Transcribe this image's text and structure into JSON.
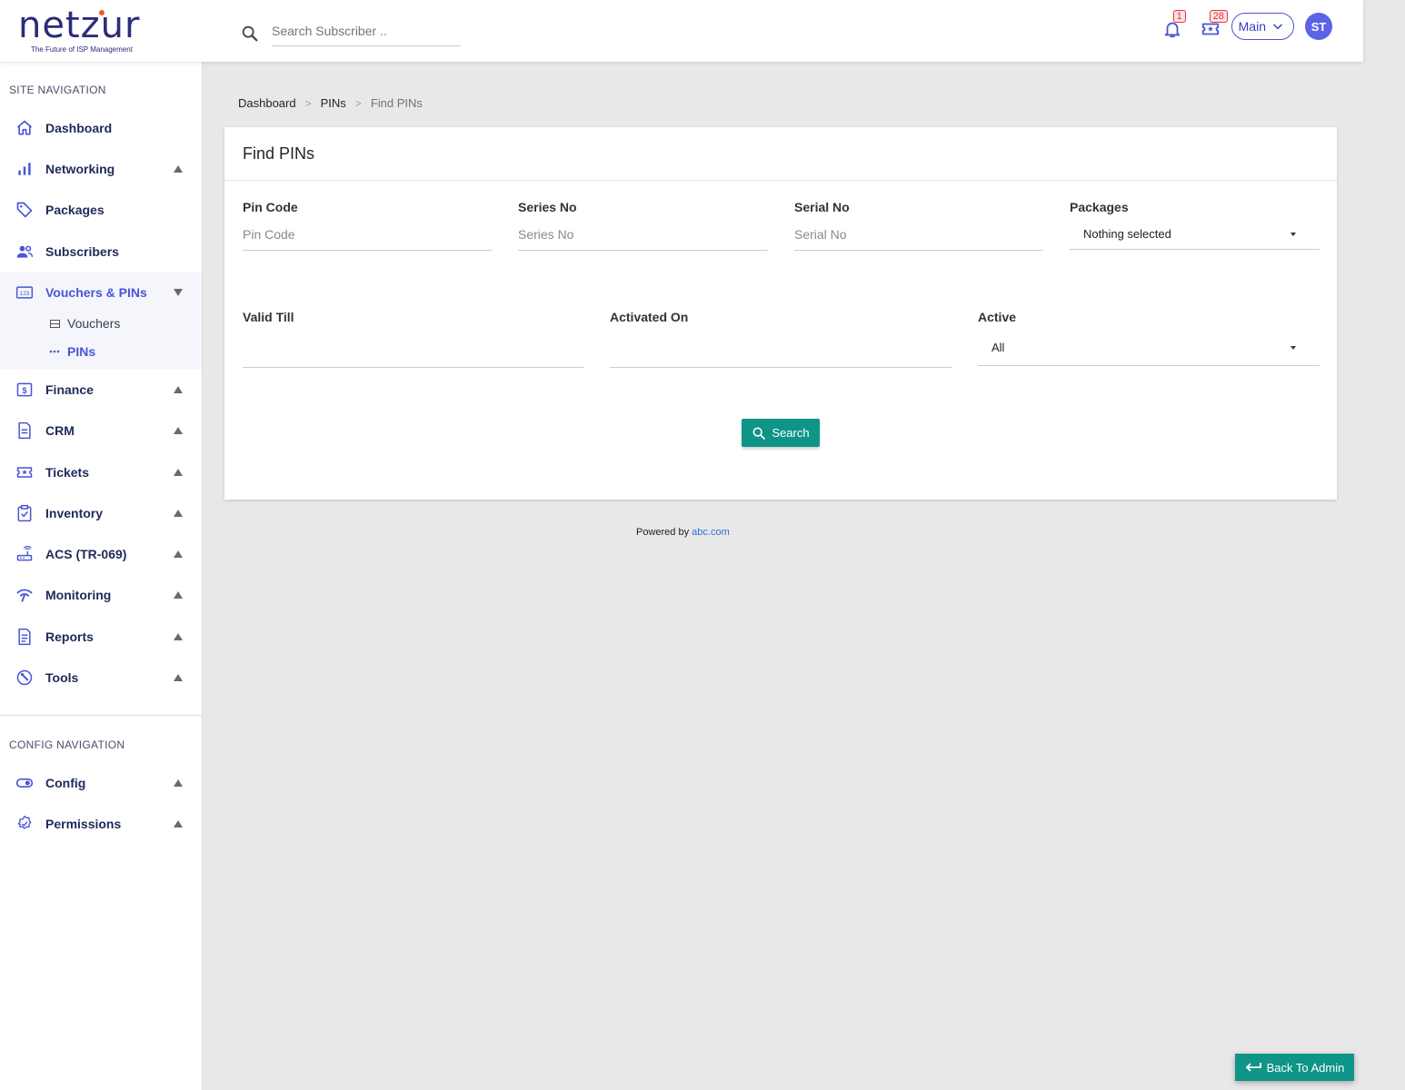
{
  "brand": {
    "name": "netzur",
    "tagline": "The Future of ISP Management"
  },
  "header": {
    "search_placeholder": "Search Subscriber ..",
    "notifications_count": "1",
    "tickets_count": "28",
    "context_select": "Main",
    "avatar_initials": "ST"
  },
  "sidebar": {
    "site_heading": "SITE NAVIGATION",
    "config_heading": "CONFIG NAVIGATION",
    "items": [
      {
        "label": "Dashboard",
        "icon": "home-icon"
      },
      {
        "label": "Networking",
        "icon": "bar-chart-icon"
      },
      {
        "label": "Packages",
        "icon": "tag-icon"
      },
      {
        "label": "Subscribers",
        "icon": "users-icon"
      },
      {
        "label": "Vouchers & PINs",
        "icon": "numbers-icon"
      },
      {
        "label": "Finance",
        "icon": "dollar-icon"
      },
      {
        "label": "CRM",
        "icon": "document-icon"
      },
      {
        "label": "Tickets",
        "icon": "ticket-icon"
      },
      {
        "label": "Inventory",
        "icon": "clipboard-check-icon"
      },
      {
        "label": "ACS (TR-069)",
        "icon": "router-icon"
      },
      {
        "label": "Monitoring",
        "icon": "signal-icon"
      },
      {
        "label": "Reports",
        "icon": "report-icon"
      },
      {
        "label": "Tools",
        "icon": "wrench-icon"
      }
    ],
    "sub_items": [
      {
        "label": "Vouchers",
        "icon": "list-icon"
      },
      {
        "label": "PINs",
        "icon": "dots-icon"
      }
    ],
    "config_items": [
      {
        "label": "Config",
        "icon": "toggle-icon"
      },
      {
        "label": "Permissions",
        "icon": "badge-check-icon"
      }
    ]
  },
  "breadcrumb": {
    "level1": "Dashboard",
    "level2": "PINs",
    "current": "Find PINs"
  },
  "form": {
    "title": "Find PINs",
    "pin_code": {
      "label": "Pin Code",
      "placeholder": "Pin Code"
    },
    "series_no": {
      "label": "Series No",
      "placeholder": "Series No"
    },
    "serial_no": {
      "label": "Serial No",
      "placeholder": "Serial No"
    },
    "packages": {
      "label": "Packages",
      "value": "Nothing selected"
    },
    "valid_till": {
      "label": "Valid Till",
      "placeholder": ""
    },
    "activated_on": {
      "label": "Activated On",
      "placeholder": ""
    },
    "active": {
      "label": "Active",
      "value": "All"
    },
    "search_button": "Search"
  },
  "footer": {
    "powered_prefix": "Powered by",
    "powered_link": "abc.com"
  },
  "back_button": "Back To Admin",
  "colors": {
    "accent": "#4a55d6",
    "teal": "#0f9488",
    "nav_text": "#1f2a5a",
    "badge": "#e0313d"
  }
}
